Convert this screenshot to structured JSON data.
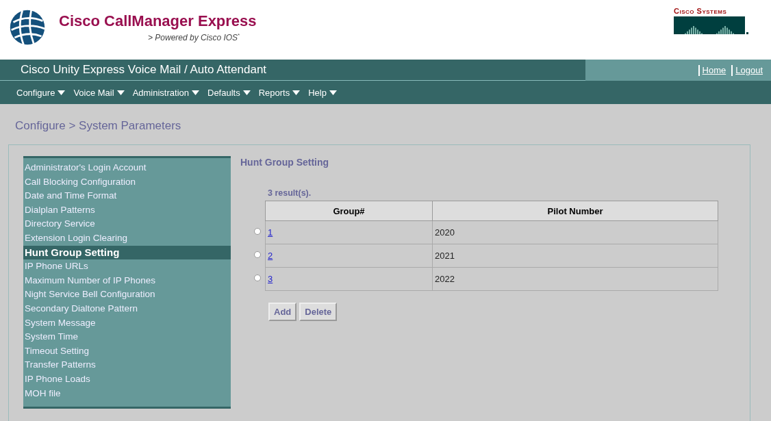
{
  "header": {
    "product": "Cisco CallManager Express",
    "tagline": "> Powered by Cisco IOS",
    "tagline_mark": "*",
    "brand": "Cisco Systems"
  },
  "title_bar": {
    "title": "Cisco Unity Express Voice Mail / Auto Attendant",
    "links": [
      "Home",
      "Logout"
    ]
  },
  "menu": [
    "Configure",
    "Voice Mail",
    "Administration",
    "Defaults",
    "Reports",
    "Help"
  ],
  "breadcrumb": "Configure > System Parameters",
  "sidebar": {
    "items": [
      {
        "label": "Administrator's Login Account",
        "selected": false
      },
      {
        "label": "Call Blocking Configuration",
        "selected": false
      },
      {
        "label": "Date and Time Format",
        "selected": false
      },
      {
        "label": "Dialplan Patterns",
        "selected": false
      },
      {
        "label": "Directory Service",
        "selected": false
      },
      {
        "label": "Extension Login Clearing",
        "selected": false
      },
      {
        "label": "Hunt Group Setting",
        "selected": true
      },
      {
        "label": "IP Phone URLs",
        "selected": false
      },
      {
        "label": "Maximum Number of IP Phones",
        "selected": false
      },
      {
        "label": "Night Service Bell Configuration",
        "selected": false
      },
      {
        "label": "Secondary Dialtone Pattern",
        "selected": false
      },
      {
        "label": "System Message",
        "selected": false
      },
      {
        "label": "System Time",
        "selected": false
      },
      {
        "label": "Timeout Setting",
        "selected": false
      },
      {
        "label": "Transfer Patterns",
        "selected": false
      },
      {
        "label": "IP Phone Loads",
        "selected": false
      },
      {
        "label": "MOH file",
        "selected": false
      }
    ]
  },
  "main": {
    "heading": "Hunt Group Setting",
    "result_count": "3 result(s).",
    "table": {
      "columns": [
        "Group#",
        "Pilot Number"
      ],
      "rows": [
        {
          "group": "1",
          "pilot": "2020",
          "selected": false
        },
        {
          "group": "2",
          "pilot": "2021",
          "selected": false
        },
        {
          "group": "3",
          "pilot": "2022",
          "selected": false
        }
      ]
    },
    "buttons": [
      "Add",
      "Delete"
    ]
  }
}
